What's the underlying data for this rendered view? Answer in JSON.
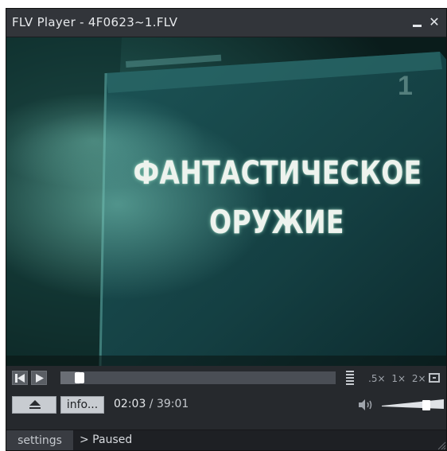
{
  "window": {
    "title": "FLV Player - 4F0623~1.FLV"
  },
  "video": {
    "caption_line1": "ФАНТАСТИЧЕСКОЕ",
    "caption_line2": "ОРУЖИЕ"
  },
  "controls": {
    "seek_progress_percent": 5.3,
    "speeds": [
      ".5×",
      "1×",
      "2×"
    ],
    "eject_icon": "eject-icon",
    "info_label": "info...",
    "time_current": "02:03",
    "time_separator": " / ",
    "time_total": "39:01",
    "volume_percent": 75
  },
  "statusbar": {
    "settings_label": "settings",
    "status_text": "> Paused"
  },
  "colors": {
    "window_bg": "#26292d",
    "title_bar": "#32353a",
    "button_light": "#c8ccd1",
    "seek_track": "#4a4e55"
  }
}
